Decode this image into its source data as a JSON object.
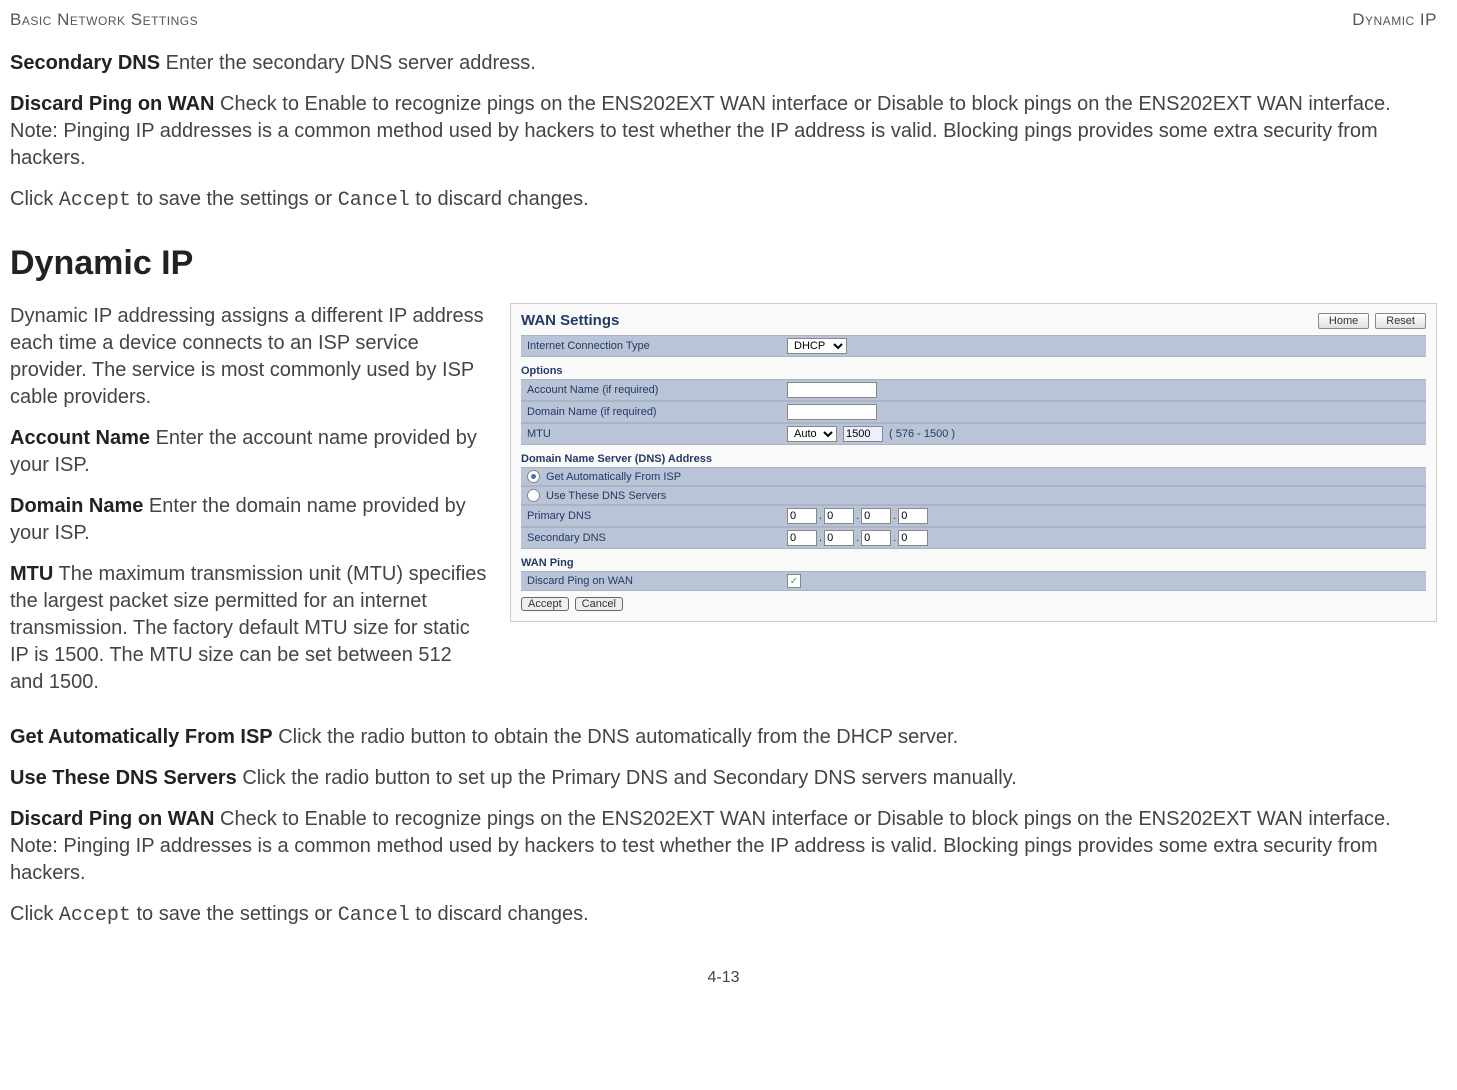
{
  "header": {
    "left": "Basic Network Settings",
    "right": "Dynamic IP"
  },
  "intro": {
    "secondary_dns_label": "Secondary DNS",
    "secondary_dns_text": "  Enter the secondary DNS server address.",
    "discard_label": "Discard Ping on WAN",
    "discard_text": "  Check to Enable to recognize pings on the ENS202EXT WAN interface or Disable to block pings on the ENS202EXT WAN interface. Note: Pinging IP addresses is a common method used by hackers to test whether the IP address is valid. Blocking pings provides some extra security from hackers.",
    "click_prefix": "Click ",
    "accept": "Accept",
    "click_middle": " to save the settings or ",
    "cancel": "Cancel",
    "click_suffix": " to discard changes."
  },
  "section_title": "Dynamic IP",
  "left": {
    "p1": "Dynamic IP addressing assigns a different IP address each time a device connects to an ISP service provider. The service is most commonly used by ISP cable providers.",
    "account_label": "Account Name",
    "account_text": "  Enter the account name provided by your ISP.",
    "domain_label": "Domain Name",
    "domain_text": "  Enter the domain name provided by your ISP.",
    "mtu_label": "MTU",
    "mtu_text": "  The maximum transmission unit (MTU) specifies the largest packet size permitted for an internet transmission. The factory default MTU size for static IP is 1500. The MTU size can be set between 512 and 1500."
  },
  "below": {
    "get_auto_label": "Get Automatically From ISP",
    "get_auto_text": "  Click the radio button to obtain the DNS automatically from the DHCP server.",
    "use_dns_label": "Use These DNS Servers",
    "use_dns_text": "  Click the radio button to set up the Primary DNS and Secondary DNS servers manually.",
    "discard_label": "Discard Ping on WAN",
    "discard_text": "  Check to Enable to recognize pings on the ENS202EXT WAN interface or Disable to block pings on the ENS202EXT WAN interface. Note: Pinging IP addresses is a common method used by hackers to test whether the IP address is valid. Blocking pings provides some extra security from hackers."
  },
  "screenshot": {
    "title": "WAN Settings",
    "home": "Home",
    "reset": "Reset",
    "conn_type_label": "Internet Connection Type",
    "conn_type_value": "DHCP",
    "options_label": "Options",
    "account_label": "Account Name (if required)",
    "domain_label": "Domain Name (if required)",
    "mtu_label": "MTU",
    "mtu_mode": "Auto",
    "mtu_value": "1500",
    "mtu_range": "( 576 - 1500 )",
    "dns_section": "Domain Name Server (DNS) Address",
    "get_auto": "Get Automatically From ISP",
    "use_these": "Use These DNS Servers",
    "primary_dns": "Primary DNS",
    "secondary_dns": "Secondary DNS",
    "ip_zero": "0",
    "wan_ping": "WAN Ping",
    "discard_ping": "Discard Ping on WAN",
    "accept": "Accept",
    "cancel": "Cancel"
  },
  "footer": "4-13"
}
